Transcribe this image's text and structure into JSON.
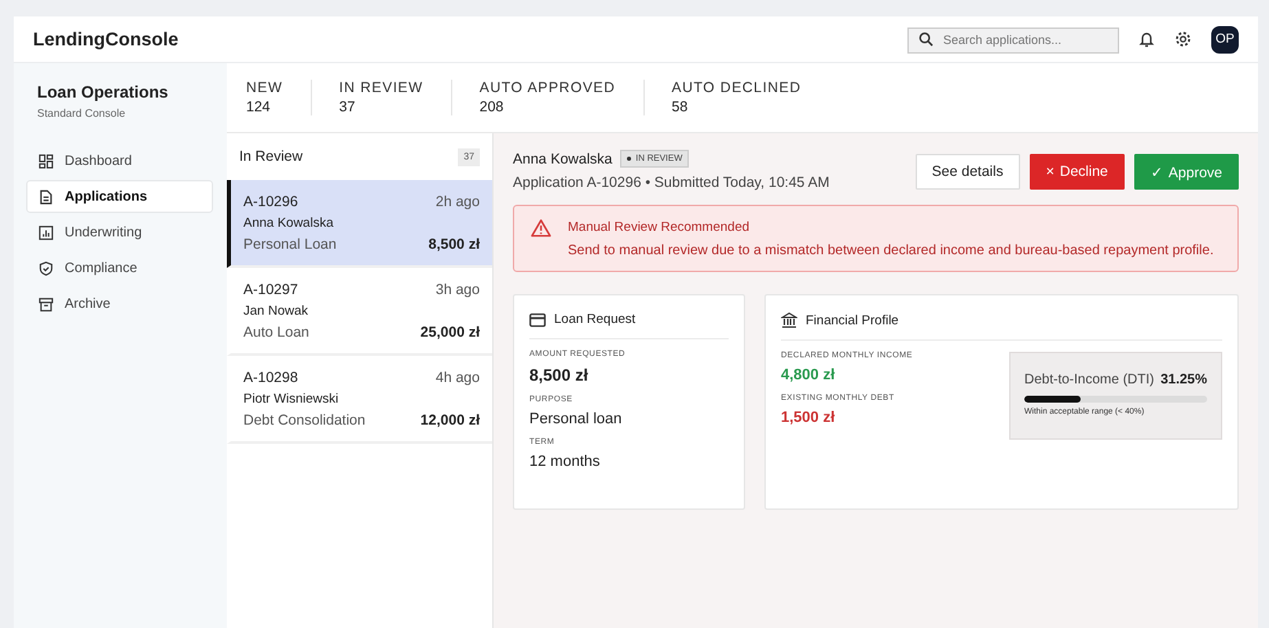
{
  "header": {
    "brand": "LendingConsole",
    "search": {
      "placeholder": "Search applications..."
    },
    "avatar": "OP"
  },
  "sidebar": {
    "title": "Loan Operations",
    "subtitle": "Standard Console",
    "items": [
      {
        "label": "Dashboard",
        "selected": false
      },
      {
        "label": "Applications",
        "selected": true
      },
      {
        "label": "Underwriting",
        "selected": false
      },
      {
        "label": "Compliance",
        "selected": false
      },
      {
        "label": "Archive",
        "selected": false
      }
    ]
  },
  "stats": [
    {
      "label": "NEW",
      "value": "124"
    },
    {
      "label": "IN REVIEW",
      "value": "37"
    },
    {
      "label": "AUTO APPROVED",
      "value": "208"
    },
    {
      "label": "AUTO DECLINED",
      "value": "58"
    }
  ],
  "queue": {
    "title": "In Review",
    "count": "37",
    "items": [
      {
        "id": "A-10296",
        "time": "2h ago",
        "name": "Anna Kowalska",
        "product": "Personal Loan",
        "amount": "8,500 zł",
        "selected": true
      },
      {
        "id": "A-10297",
        "time": "3h ago",
        "name": "Jan Nowak",
        "product": "Auto Loan",
        "amount": "25,000 zł",
        "selected": false
      },
      {
        "id": "A-10298",
        "time": "4h ago",
        "name": "Piotr Wisniewski",
        "product": "Debt Consolidation",
        "amount": "12,000 zł",
        "selected": false
      }
    ]
  },
  "detail": {
    "name": "Anna Kowalska",
    "status": "IN REVIEW",
    "subtitle": "Application A-10296 • Submitted Today, 10:45 AM",
    "buttons": [
      {
        "label": "See details",
        "kind": "secondary"
      },
      {
        "label": "Decline",
        "kind": "danger",
        "icon": "×"
      },
      {
        "label": "Approve",
        "kind": "success",
        "icon": "✓"
      }
    ],
    "alert": {
      "title": "Manual Review Recommended",
      "message": "Send to manual review due to a mismatch between declared income and bureau-based repayment profile."
    },
    "loan_request": {
      "title": "Loan Request",
      "fields": [
        {
          "label": "AMOUNT REQUESTED",
          "value": "8,500 zł",
          "kind": "strong"
        },
        {
          "label": "PURPOSE",
          "value": "Personal loan",
          "kind": "plain"
        },
        {
          "label": "TERM",
          "value": "12 months",
          "kind": "plain"
        }
      ]
    },
    "financial_profile": {
      "title": "Financial Profile",
      "fields": [
        {
          "label": "DECLARED MONTHLY INCOME",
          "value": "4,800 zł",
          "kind": "positive"
        },
        {
          "label": "EXISTING MONTHLY DEBT",
          "value": "1,500 zł",
          "kind": "negative"
        }
      ],
      "dti": {
        "label": "Debt-to-Income (DTI)",
        "value": "31.25%",
        "level": 0.31,
        "note": "Within acceptable range (< 40%)"
      }
    }
  }
}
